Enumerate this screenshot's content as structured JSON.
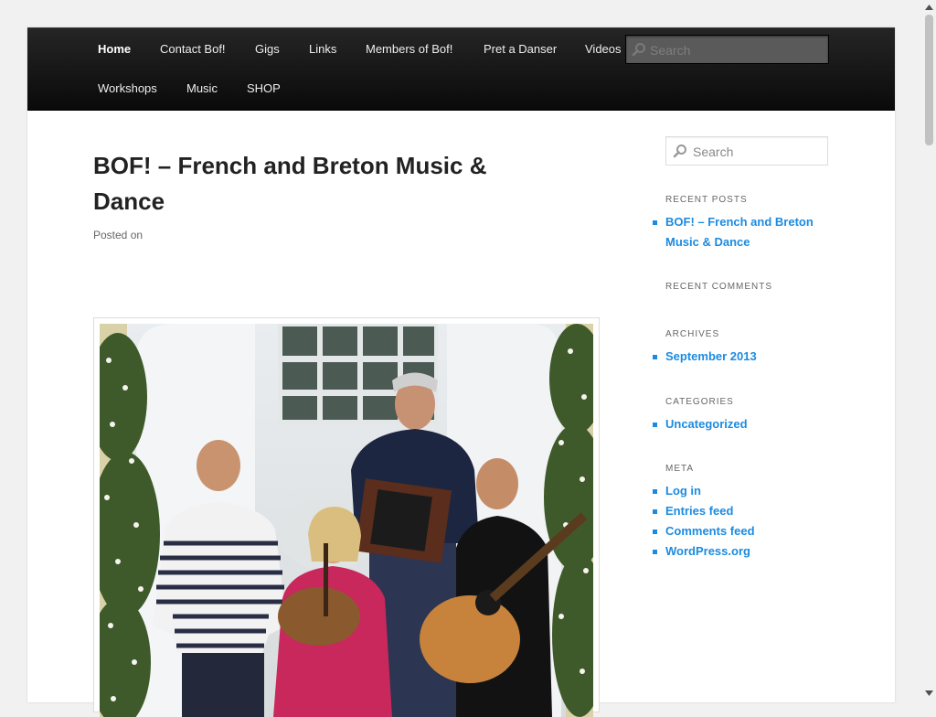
{
  "nav": {
    "items": [
      {
        "label": "Home",
        "active": true
      },
      {
        "label": "Contact Bof!"
      },
      {
        "label": "Gigs"
      },
      {
        "label": "Links"
      },
      {
        "label": "Members of Bof!"
      },
      {
        "label": "Pret a Danser"
      },
      {
        "label": "Videos"
      },
      {
        "label": "Workshops"
      },
      {
        "label": "Music"
      },
      {
        "label": "SHOP"
      }
    ],
    "search_placeholder": "Search"
  },
  "post": {
    "title": "BOF! – French and Breton Music & Dance",
    "meta": "Posted on",
    "image_subject": "band-photo-icon"
  },
  "sidebar": {
    "search_placeholder": "Search",
    "recent_posts": {
      "heading": "RECENT POSTS",
      "items": [
        "BOF! – French and Breton Music & Dance"
      ]
    },
    "recent_comments": {
      "heading": "RECENT COMMENTS"
    },
    "archives": {
      "heading": "ARCHIVES",
      "items": [
        "September 2013"
      ]
    },
    "categories": {
      "heading": "CATEGORIES",
      "items": [
        "Uncategorized"
      ]
    },
    "meta": {
      "heading": "META",
      "items": [
        "Log in",
        "Entries feed",
        "Comments feed",
        "WordPress.org"
      ]
    }
  },
  "colors": {
    "nav_bg": "#111111",
    "link": "#1b8be0",
    "page_bg": "#f1f1f1"
  }
}
